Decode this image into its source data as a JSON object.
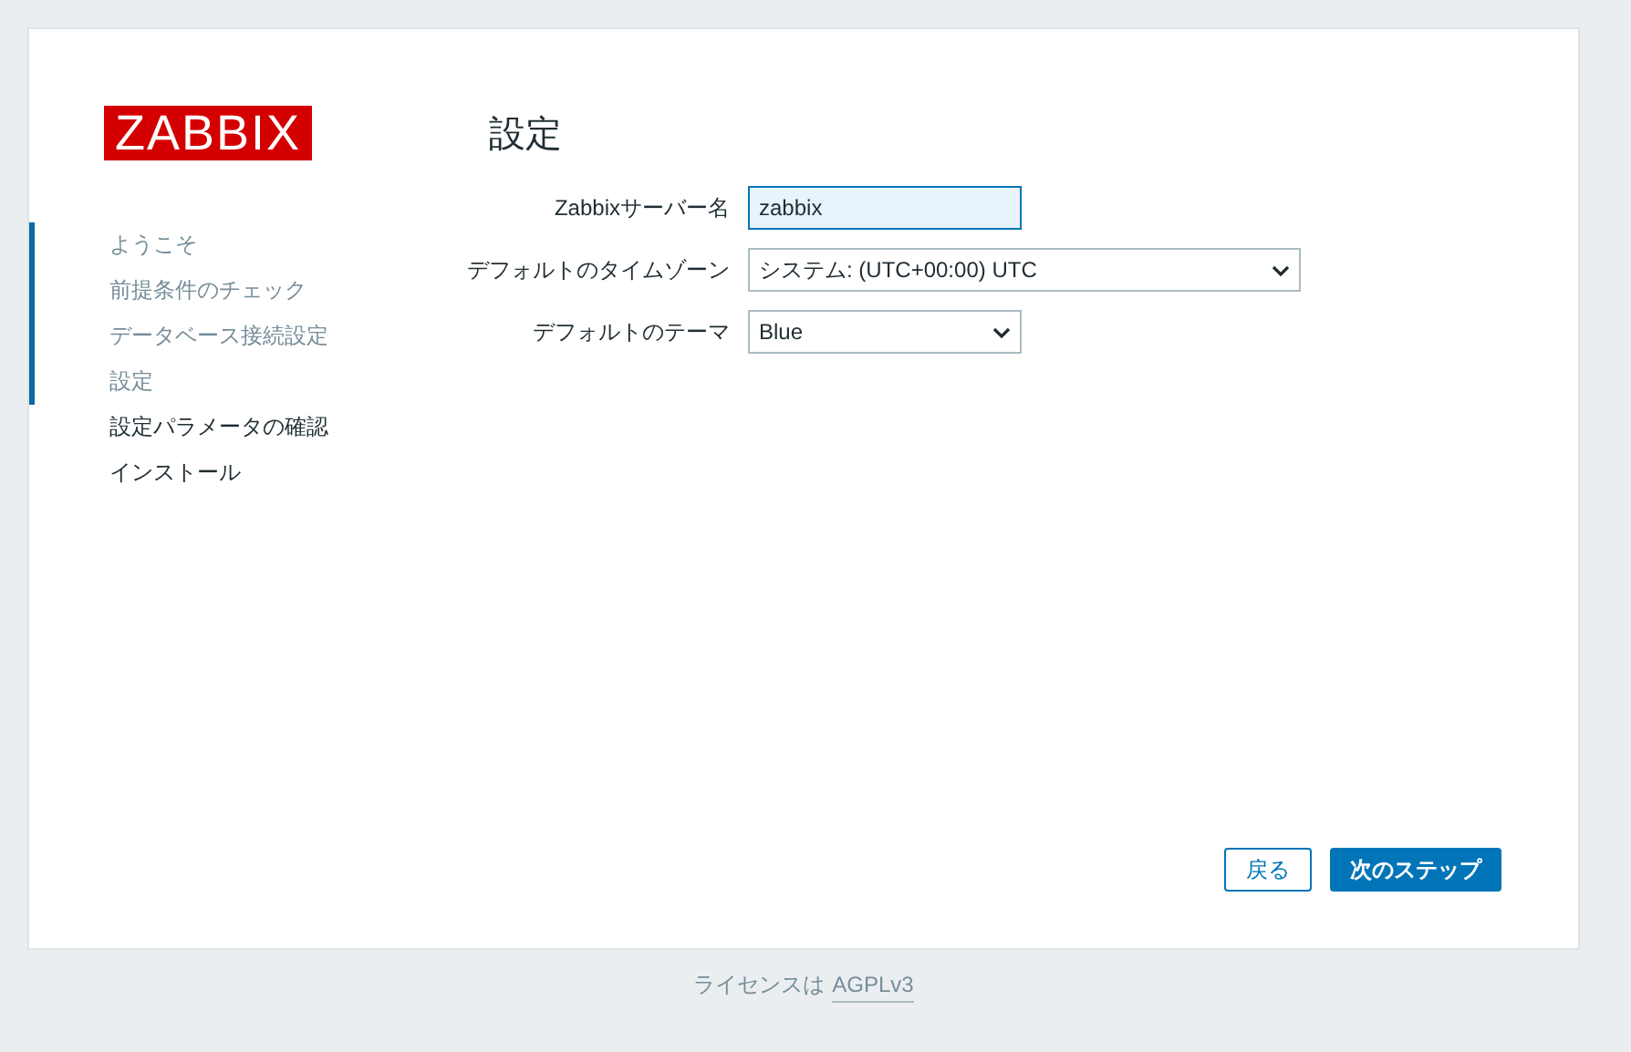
{
  "logo": {
    "text": "ZABBIX"
  },
  "steps": [
    {
      "label": "ようこそ",
      "completed": true
    },
    {
      "label": "前提条件のチェック",
      "completed": true
    },
    {
      "label": "データベース接続設定",
      "completed": true
    },
    {
      "label": "設定",
      "completed": true
    },
    {
      "label": "設定パラメータの確認",
      "completed": false
    },
    {
      "label": "インストール",
      "completed": false
    }
  ],
  "title": "設定",
  "fields": [
    {
      "kind": "text",
      "label": "Zabbixサーバー名",
      "value": "zabbix",
      "focused": true
    },
    {
      "kind": "select",
      "label": "デフォルトのタイムゾーン",
      "value": "システム: (UTC+00:00) UTC",
      "wide": true
    },
    {
      "kind": "select",
      "label": "デフォルトのテーマ",
      "value": "Blue",
      "wide": false
    }
  ],
  "buttons": {
    "back": "戻る",
    "next": "次のステップ"
  },
  "footer": {
    "text": "ライセンスは",
    "link": "AGPLv3"
  }
}
